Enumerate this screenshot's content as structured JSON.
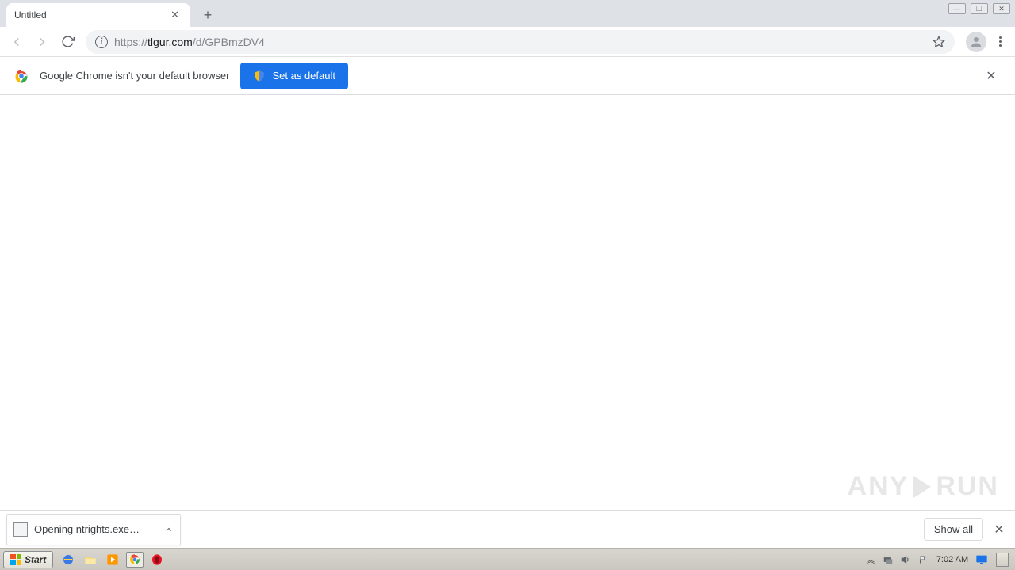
{
  "tab": {
    "title": "Untitled"
  },
  "url": {
    "scheme": "https://",
    "host": "tlgur.com",
    "path": "/d/GPBmzDV4"
  },
  "infobar": {
    "message": "Google Chrome isn't your default browser",
    "button": "Set as default"
  },
  "download": {
    "filename": "Opening ntrights.exe…"
  },
  "shelf": {
    "show_all": "Show all"
  },
  "taskbar": {
    "start": "Start",
    "time": "7:02 AM"
  },
  "watermark": {
    "left": "ANY",
    "right": "RUN"
  }
}
